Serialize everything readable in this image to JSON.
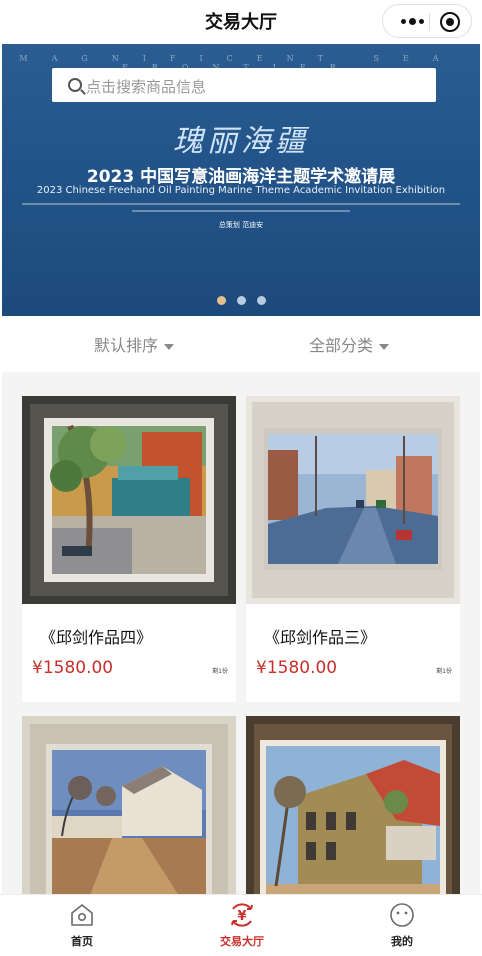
{
  "header": {
    "title": "交易大厅"
  },
  "banner": {
    "search_placeholder": "点击搜索商品信息",
    "top_strip": "MAGNIFICENT SEA FRONTIER",
    "calligraphy": "瑰丽海疆",
    "title_zh": "2023 中国写意油画海洋主题学术邀请展",
    "title_en": "2023 Chinese Freehand Oil Painting Marine Theme Academic Invitation Exhibition",
    "planner": "总策划  范迪安",
    "active_slide": 1,
    "slide_count": 3
  },
  "filters": [
    {
      "label": "默认排序"
    },
    {
      "label": "全部分类"
    }
  ],
  "products": [
    {
      "name": "《邱剑作品四》",
      "price": "¥1580.00",
      "stock": "剩1份"
    },
    {
      "name": "《邱剑作品三》",
      "price": "¥1580.00",
      "stock": "剩1份"
    },
    {
      "name": "",
      "price": "",
      "stock": ""
    },
    {
      "name": "",
      "price": "",
      "stock": ""
    }
  ],
  "tabbar": [
    {
      "label": "首页",
      "icon": "home-icon"
    },
    {
      "label": "交易大厅",
      "icon": "trade-yuan-icon"
    },
    {
      "label": "我的",
      "icon": "profile-face-icon"
    }
  ],
  "colors": {
    "accent": "#c9302c",
    "banner_blue": "#22548a",
    "dot_active": "#e6c08e"
  }
}
